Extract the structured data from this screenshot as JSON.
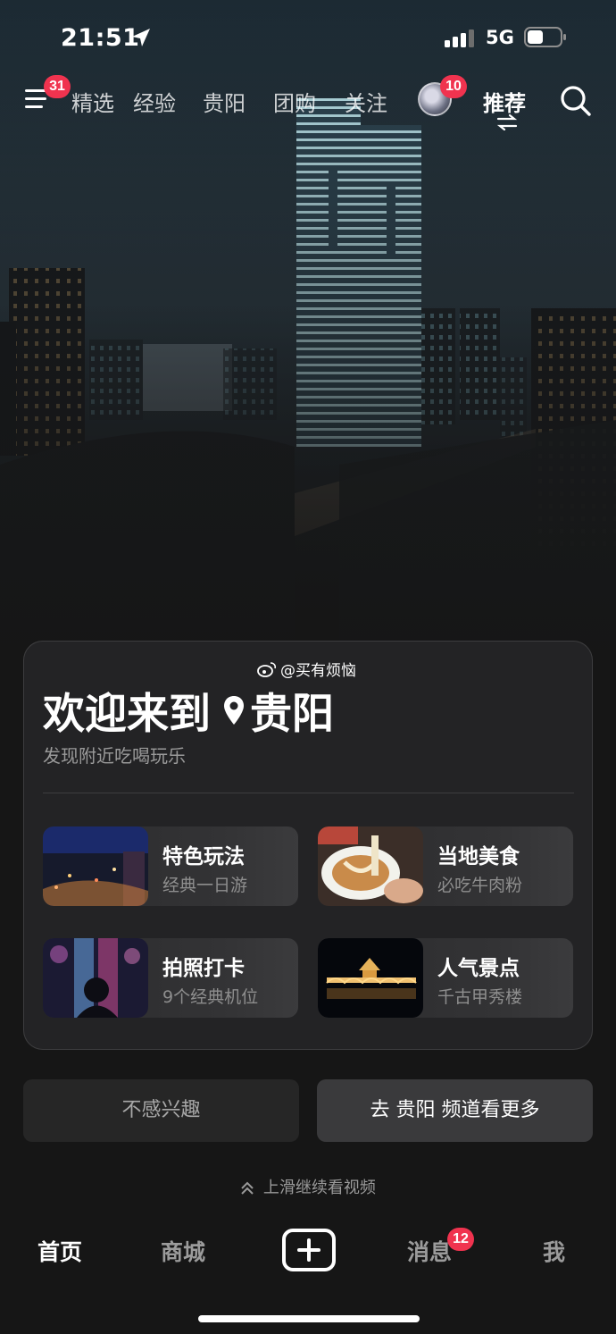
{
  "status_bar": {
    "time": "21:51",
    "network": "5G"
  },
  "top_nav": {
    "menu_badge": "31",
    "tabs": [
      "精选",
      "经验",
      "贵阳",
      "团购",
      "关注"
    ],
    "avatar_badge": "10",
    "active_tab": "推荐"
  },
  "card": {
    "watermark": "@买有烦恼",
    "welcome_prefix": "欢迎来到",
    "city": "贵阳",
    "subtitle": "发现附近吃喝玩乐",
    "tiles": [
      {
        "title": "特色玩法",
        "subtitle": "经典一日游"
      },
      {
        "title": "当地美食",
        "subtitle": "必吃牛肉粉"
      },
      {
        "title": "拍照打卡",
        "subtitle": "9个经典机位"
      },
      {
        "title": "人气景点",
        "subtitle": "千古甲秀楼"
      }
    ]
  },
  "actions": {
    "dislike": "不感兴趣",
    "more": "去 贵阳 频道看更多"
  },
  "swipe_hint": "上滑继续看视频",
  "bottom_tabs": {
    "home": "首页",
    "mall": "商城",
    "messages": "消息",
    "messages_badge": "12",
    "me": "我"
  },
  "colors": {
    "badge": "#f0334f",
    "card_bg": "#242426",
    "accent_text": "#ffffff"
  }
}
